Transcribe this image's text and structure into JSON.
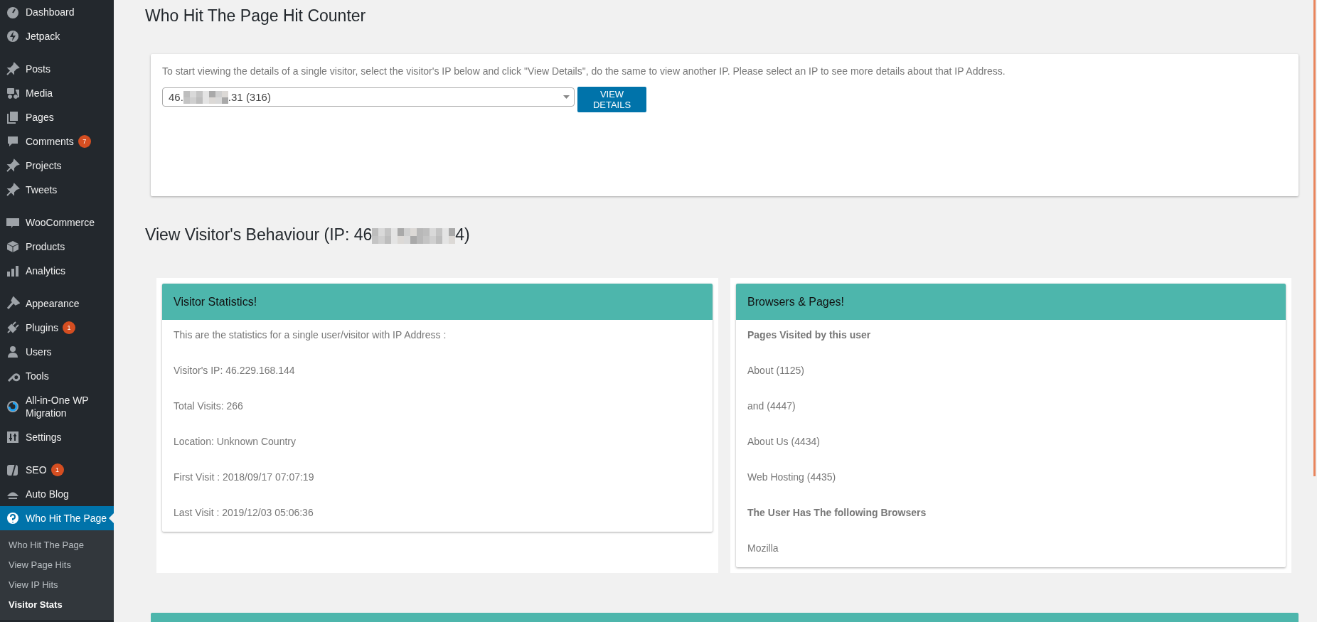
{
  "sidebar": {
    "groups": [
      [
        {
          "label": "Dashboard",
          "selected": false
        },
        {
          "label": "Jetpack",
          "selected": false
        }
      ],
      [
        {
          "label": "Posts",
          "selected": false
        },
        {
          "label": "Media",
          "selected": false
        },
        {
          "label": "Pages",
          "selected": false
        },
        {
          "label": "Comments",
          "badge": "7",
          "selected": false
        },
        {
          "label": "Projects",
          "selected": false
        },
        {
          "label": "Tweets",
          "selected": false
        }
      ],
      [
        {
          "label": "WooCommerce",
          "selected": false
        },
        {
          "label": "Products",
          "selected": false
        },
        {
          "label": "Analytics",
          "selected": false
        }
      ],
      [
        {
          "label": "Appearance",
          "selected": false
        },
        {
          "label": "Plugins",
          "badge": "1",
          "selected": false
        },
        {
          "label": "Users",
          "selected": false
        },
        {
          "label": "Tools",
          "selected": false
        },
        {
          "label": "All-in-One WP Migration",
          "selected": false
        },
        {
          "label": "Settings",
          "selected": false
        }
      ],
      [
        {
          "label": "SEO",
          "badge": "1",
          "selected": false
        },
        {
          "label": "Auto Blog",
          "selected": false
        },
        {
          "label": "Who Hit The Page",
          "selected": true
        }
      ]
    ],
    "submenu": [
      {
        "label": "Who Hit The Page",
        "selected": false
      },
      {
        "label": "View Page Hits",
        "selected": false
      },
      {
        "label": "View IP Hits",
        "selected": false
      },
      {
        "label": "Visitor Stats",
        "selected": true
      }
    ]
  },
  "page_title": "Who Hit The Page Hit Counter",
  "selector_card": {
    "instructions": "To start viewing the details of a single visitor, select the visitor's IP below and click \"View Details\", do the same to view another IP. Please select an IP to see more details about that IP Address.",
    "ip_select": {
      "value_start": "46.",
      "value_end": ".31 (316)"
    },
    "button": "VIEW DETAILS"
  },
  "behaviour_heading": {
    "start": "View Visitor's Behaviour (IP: 46",
    "end": "4)"
  },
  "cards": [
    {
      "title": "Visitor Statistics!",
      "lines": [
        {
          "text": "This are the statistics for a single user/visitor with IP Address :",
          "kind": "plain"
        },
        {
          "text": "Visitor's IP: 46.229.168.144",
          "kind": "plain"
        },
        {
          "text": "Total Visits: 266",
          "kind": "plain"
        },
        {
          "text": "Location: Unknown Country",
          "kind": "plain"
        },
        {
          "text": "First Visit : 2018/09/17 07:07:19",
          "kind": "plain"
        },
        {
          "text": "Last Visit : 2019/12/03 05:06:36",
          "kind": "plain"
        }
      ]
    },
    {
      "title": "Browsers & Pages!",
      "lines": [
        {
          "text": "Pages Visited by this user",
          "kind": "heading"
        },
        {
          "text": "About (1125)",
          "kind": "plain"
        },
        {
          "text": "and (4447)",
          "kind": "plain"
        },
        {
          "text": "About Us (4434)",
          "kind": "plain"
        },
        {
          "text": "Web Hosting (4435)",
          "kind": "plain"
        },
        {
          "text": "The User Has The following Browsers",
          "kind": "heading"
        },
        {
          "text": "Mozilla",
          "kind": "plain"
        }
      ]
    }
  ]
}
